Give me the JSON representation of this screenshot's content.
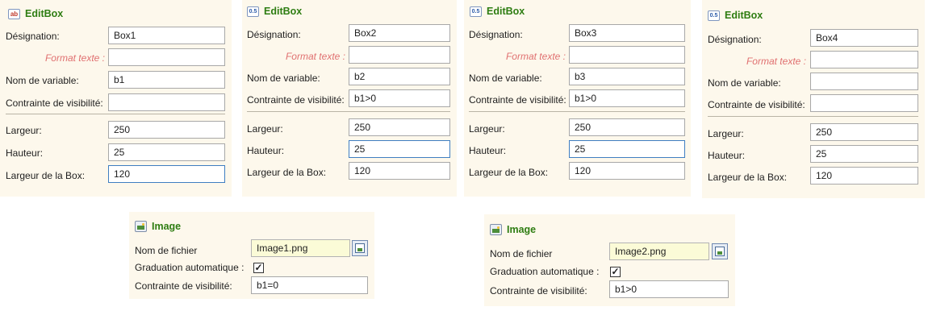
{
  "editbox_panels": [
    {
      "icon": "ab-icon",
      "title": "EditBox",
      "designation_label": "Désignation:",
      "designation_value": "Box1",
      "format_label": "Format texte :",
      "format_value": "",
      "variable_label": "Nom de variable:",
      "variable_value": "b1",
      "visibility_label": "Contrainte de visibilité:",
      "visibility_value": "",
      "width_label": "Largeur:",
      "width_value": "250",
      "height_label": "Hauteur:",
      "height_value": "25",
      "boxwidth_label": "Largeur de la Box:",
      "boxwidth_value": "120"
    },
    {
      "icon": "decimal-icon",
      "title": "EditBox",
      "designation_label": "Désignation:",
      "designation_value": "Box2",
      "format_label": "Format texte :",
      "format_value": "",
      "variable_label": "Nom de variable:",
      "variable_value": "b2",
      "visibility_label": "Contrainte de visibilité:",
      "visibility_value": "b1>0",
      "width_label": "Largeur:",
      "width_value": "250",
      "height_label": "Hauteur:",
      "height_value": "25",
      "boxwidth_label": "Largeur de la Box:",
      "boxwidth_value": "120"
    },
    {
      "icon": "decimal-icon",
      "title": "EditBox",
      "designation_label": "Désignation:",
      "designation_value": "Box3",
      "format_label": "Format texte :",
      "format_value": "",
      "variable_label": "Nom de variable:",
      "variable_value": "b3",
      "visibility_label": "Contrainte de visibilité:",
      "visibility_value": "b1>0",
      "width_label": "Largeur:",
      "width_value": "250",
      "height_label": "Hauteur:",
      "height_value": "25",
      "boxwidth_label": "Largeur de la Box:",
      "boxwidth_value": "120"
    },
    {
      "icon": "decimal-icon",
      "title": "EditBox",
      "designation_label": "Désignation:",
      "designation_value": "Box4",
      "format_label": "Format texte :",
      "format_value": "",
      "variable_label": "Nom de variable:",
      "variable_value": "",
      "visibility_label": "Contrainte de visibilité:",
      "visibility_value": "",
      "width_label": "Largeur:",
      "width_value": "250",
      "height_label": "Hauteur:",
      "height_value": "25",
      "boxwidth_label": "Largeur de la Box:",
      "boxwidth_value": "120"
    }
  ],
  "image_panels": [
    {
      "icon": "image-icon",
      "title": "Image",
      "file_label": "Nom de fichier",
      "file_value": "Image1.png",
      "autoscale_label": "Graduation automatique :",
      "autoscale_checked": "✓",
      "visibility_label": "Contrainte de visibilité:",
      "visibility_value": "b1=0"
    },
    {
      "icon": "image-icon",
      "title": "Image",
      "file_label": "Nom de fichier",
      "file_value": "Image2.png",
      "autoscale_label": "Graduation automatique :",
      "autoscale_checked": "✓",
      "visibility_label": "Contrainte de visibilité:",
      "visibility_value": "b1>0"
    }
  ],
  "colors": {
    "panel_bg": "#fdf8ec",
    "title_green": "#2e7d12",
    "format_label_red": "#e07070",
    "file_field_yellow": "#fbfbd7",
    "focus_blue": "#3f7ec1"
  }
}
